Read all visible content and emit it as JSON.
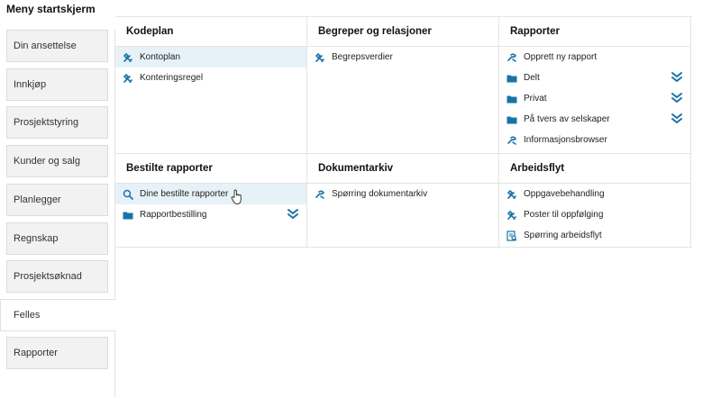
{
  "page_title": "Meny startskjerm",
  "tabs": [
    {
      "label": "Din ansettelse",
      "active": false
    },
    {
      "label": "Innkjøp",
      "active": false
    },
    {
      "label": "Prosjektstyring",
      "active": false
    },
    {
      "label": "Kunder og salg",
      "active": false
    },
    {
      "label": "Planlegger",
      "active": false
    },
    {
      "label": "Regnskap",
      "active": false
    },
    {
      "label": "Prosjektsøknad",
      "active": false
    },
    {
      "label": "Felles",
      "active": true
    },
    {
      "label": "Rapporter",
      "active": false
    }
  ],
  "sections": {
    "kodeplan": {
      "title": "Kodeplan",
      "items": [
        {
          "label": "Kontoplan",
          "icon": "tools-icon"
        },
        {
          "label": "Konteringsregel",
          "icon": "tools-icon"
        }
      ]
    },
    "begreper": {
      "title": "Begreper og relasjoner",
      "items": [
        {
          "label": "Begrepsverdier",
          "icon": "tools-icon"
        }
      ]
    },
    "rapporter": {
      "title": "Rapporter",
      "items": [
        {
          "label": "Opprett ny rapport",
          "icon": "report-icon"
        },
        {
          "label": "Delt",
          "icon": "folder-icon"
        },
        {
          "label": "Privat",
          "icon": "folder-icon"
        },
        {
          "label": "På tvers av selskaper",
          "icon": "folder-icon"
        },
        {
          "label": "Informasjonsbrowser",
          "icon": "report-icon"
        }
      ]
    },
    "bestilte": {
      "title": "Bestilte rapporter",
      "items": [
        {
          "label": "Dine bestilte rapporter",
          "icon": "search-icon"
        },
        {
          "label": "Rapportbestilling",
          "icon": "folder-icon"
        }
      ]
    },
    "dokumentarkiv": {
      "title": "Dokumentarkiv",
      "items": [
        {
          "label": "Spørring dokumentarkiv",
          "icon": "report-icon"
        }
      ]
    },
    "arbeidsflyt": {
      "title": "Arbeidsflyt",
      "items": [
        {
          "label": "Oppgavebehandling",
          "icon": "tools-icon"
        },
        {
          "label": "Poster til oppfølging",
          "icon": "tools-icon"
        },
        {
          "label": "Spørring arbeidsflyt",
          "icon": "query-icon"
        }
      ]
    }
  },
  "colors": {
    "accent": "#1a73a8",
    "highlight": "#e7f2f8",
    "border": "#e4e4e4",
    "tab_bg": "#f2f2f2"
  }
}
